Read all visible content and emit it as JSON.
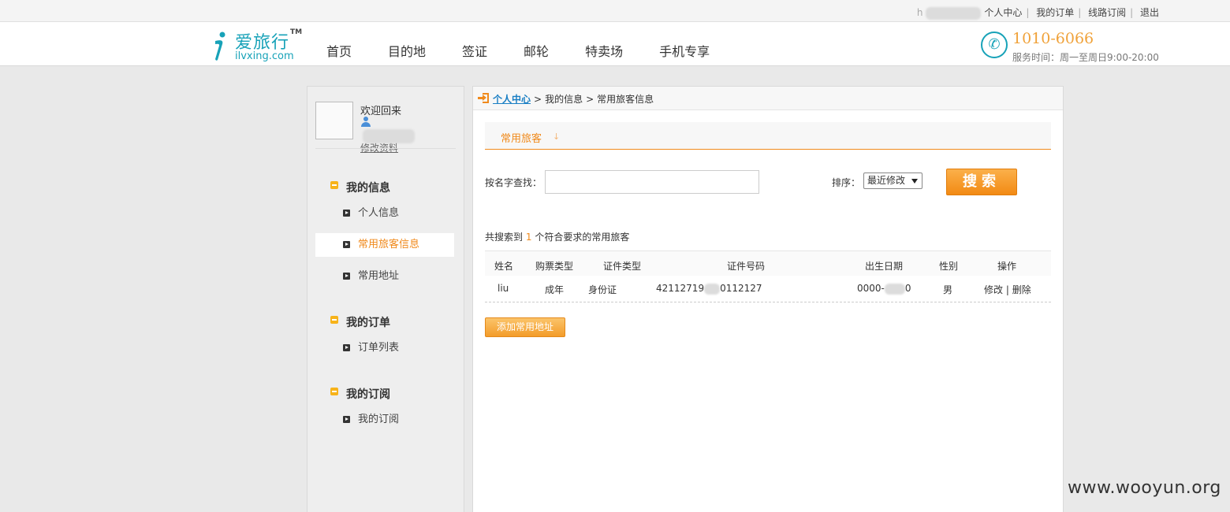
{
  "topbar": {
    "user_prefix": "h",
    "links": [
      "个人中心",
      "我的订单",
      "线路订阅",
      "退出"
    ]
  },
  "header": {
    "logo_name": "爱旅行",
    "logo_tm": "TM",
    "logo_domain": "ilvxing.com",
    "nav": [
      "首页",
      "目的地",
      "签证",
      "邮轮",
      "特卖场",
      "手机专享"
    ],
    "phone": "1010-6066",
    "service_time": "服务时间：周一至周日9:00-20:00"
  },
  "sidebar": {
    "welcome": "欢迎回来",
    "edit_profile": "修改资料",
    "sections": [
      {
        "title": "我的信息",
        "items": [
          "个人信息",
          "常用旅客信息",
          "常用地址"
        ]
      },
      {
        "title": "我的订单",
        "items": [
          "订单列表"
        ]
      },
      {
        "title": "我的订阅",
        "items": [
          "我的订阅"
        ]
      }
    ],
    "active_item": "常用旅客信息"
  },
  "breadcrumb": {
    "home": "个人中心",
    "sep": ">",
    "level1": "我的信息",
    "level2": "常用旅客信息"
  },
  "tab": {
    "label": "常用旅客",
    "arrow": "↓"
  },
  "search": {
    "label": "按名字查找：",
    "value": "",
    "sort_label": "排序：",
    "sort_selected": "最近修改",
    "button": "搜索"
  },
  "result": {
    "prefix": "共搜索到",
    "count": "1",
    "suffix": "个符合要求的常用旅客"
  },
  "table": {
    "headers": [
      "姓名",
      "购票类型",
      "证件类型",
      "证件号码",
      "出生日期",
      "性别",
      "操作"
    ],
    "rows": [
      {
        "name": "liu",
        "ticket_type": "成年",
        "id_type": "身份证",
        "id_number_start": "42112719",
        "id_number_end": "0112127",
        "birth_start": "0000-",
        "birth_end": "0",
        "gender": "男",
        "action_edit": "修改",
        "action_sep": "|",
        "action_delete": "删除"
      }
    ]
  },
  "add_button": "添加常用地址",
  "watermark": "www.wooyun.org",
  "colors": {
    "accent_orange": "#f08a1c",
    "brand_teal": "#17a2b8",
    "link_blue": "#1a7fc4"
  }
}
